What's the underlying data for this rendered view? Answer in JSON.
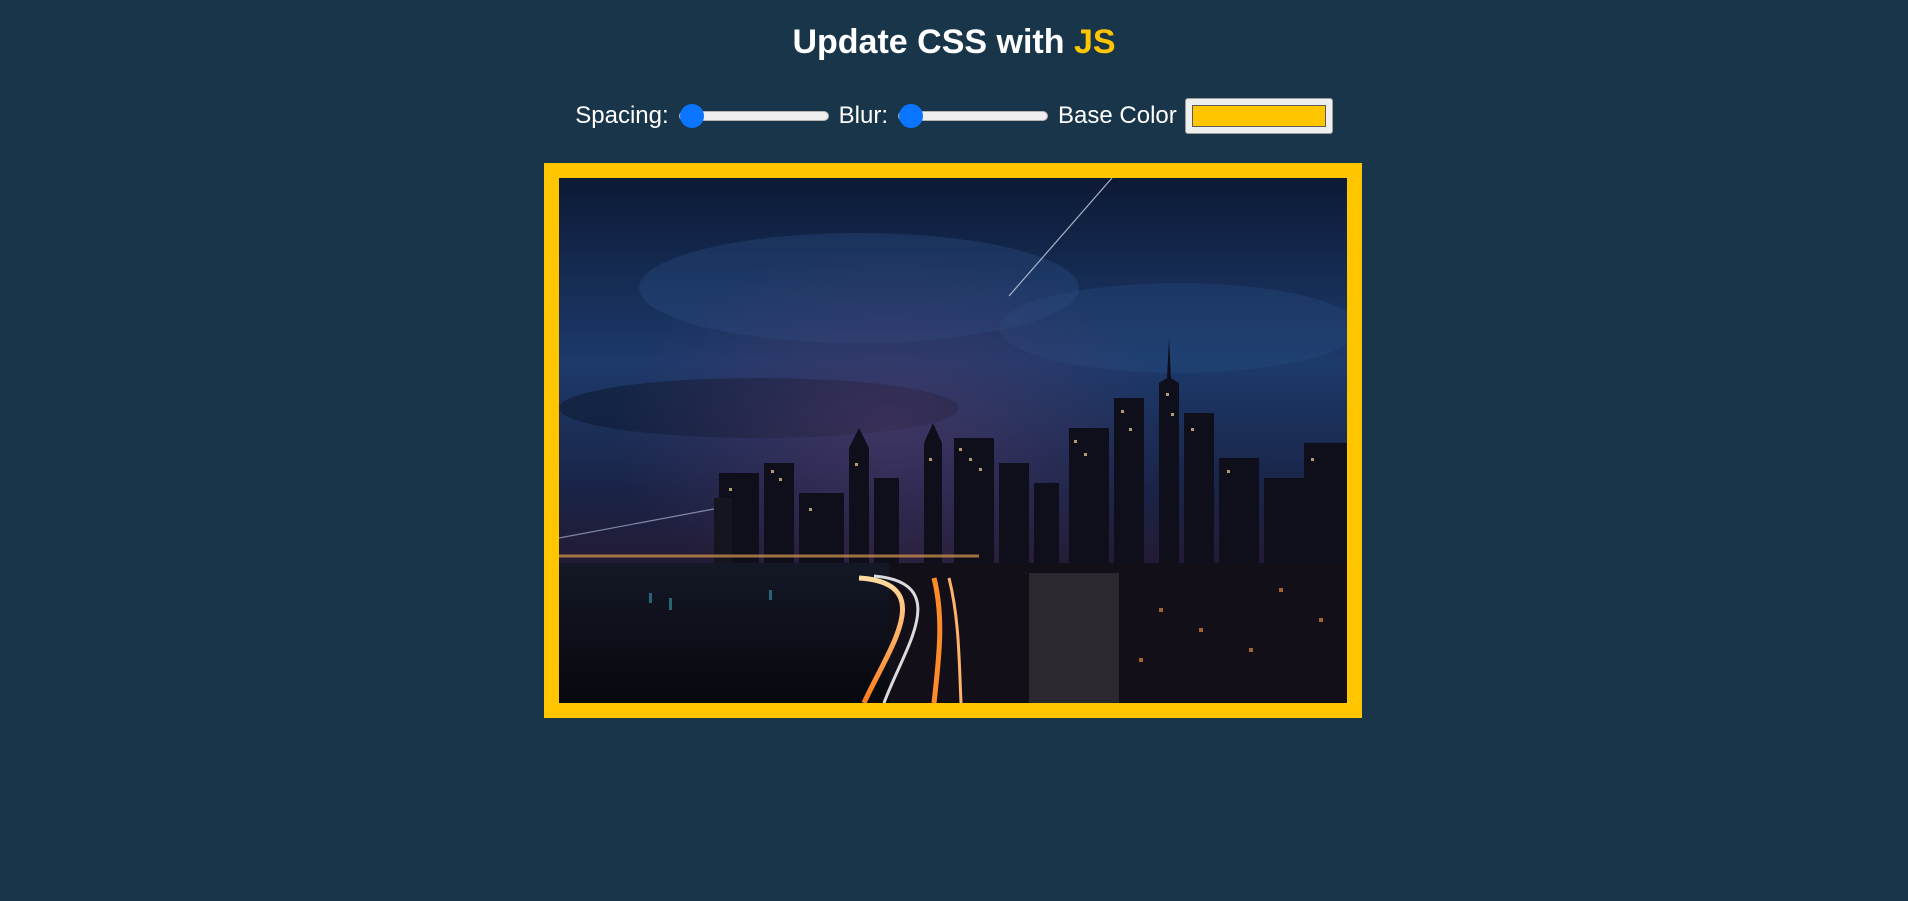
{
  "header": {
    "title_prefix": "Update CSS with ",
    "title_highlight": "JS"
  },
  "controls": {
    "spacing_label": "Spacing:",
    "spacing_value": 10,
    "spacing_min": 10,
    "spacing_max": 200,
    "blur_label": "Blur:",
    "blur_value": 0,
    "blur_min": 0,
    "blur_max": 25,
    "base_color_label": "Base Color",
    "base_color_value": "#ffc600"
  },
  "colors": {
    "background": "#193549",
    "accent": "#ffc600",
    "slider_thumb": "#0a75ff"
  },
  "image": {
    "subject": "night-city-skyline-photo"
  }
}
